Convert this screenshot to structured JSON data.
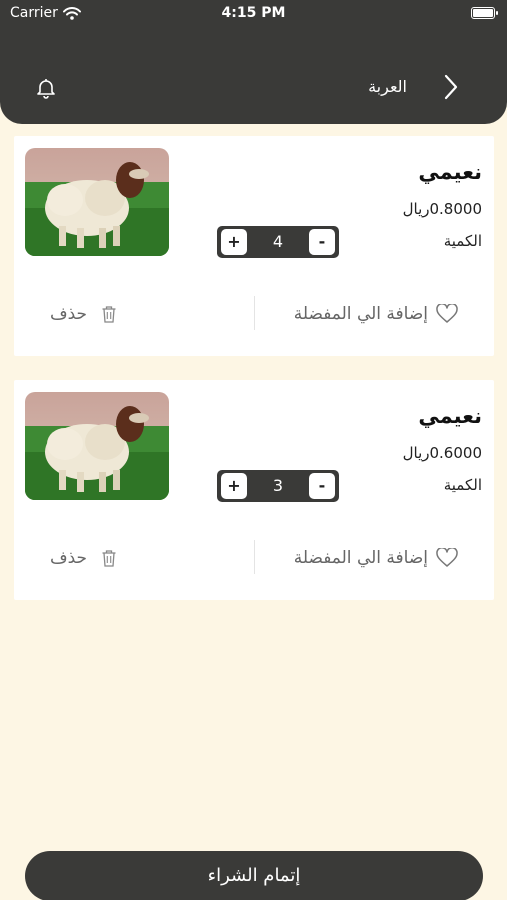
{
  "status": {
    "carrier": "Carrier",
    "time": "4:15 PM",
    "battery_level": 1.0
  },
  "header": {
    "title": "العربة",
    "back_icon": "chevron-right-icon",
    "bell_icon": "bell-icon"
  },
  "cart": {
    "items": [
      {
        "name": "نعيمي",
        "price": "0.8000ريال",
        "quantity_label": "الكمية",
        "quantity": "4",
        "plus": "+",
        "minus": "-",
        "favorite_label": "إضافة الي المفضلة",
        "delete_label": "حذف",
        "image": "sheep-photo"
      },
      {
        "name": "نعيمي",
        "price": "0.6000ريال",
        "quantity_label": "الكمية",
        "quantity": "3",
        "plus": "+",
        "minus": "-",
        "favorite_label": "إضافة الي المفضلة",
        "delete_label": "حذف",
        "image": "sheep-photo"
      }
    ]
  },
  "footer": {
    "checkout_label": "إتمام الشراء"
  },
  "colors": {
    "header_bg": "#3a3a38",
    "page_bg": "#fdf6e4",
    "card_bg": "#ffffff",
    "button_bg": "#3a3a38"
  }
}
